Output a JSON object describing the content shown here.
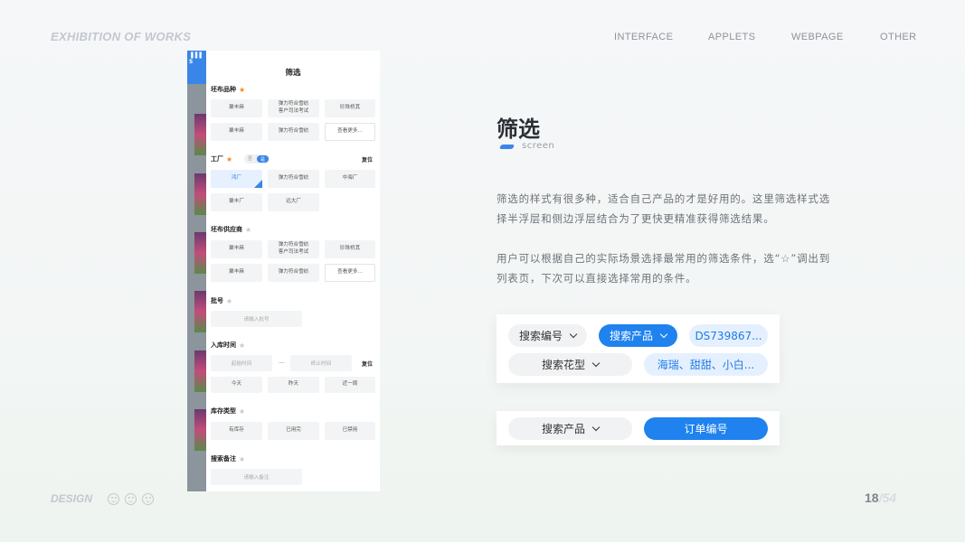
{
  "header": {
    "brand": "EXHIBITION OF WORKS",
    "nav": [
      "INTERFACE",
      "APPLETS",
      "WEBPAGE",
      "OTHER"
    ]
  },
  "footer": {
    "design": "DESIGN",
    "page_current": "18",
    "page_total": "/54"
  },
  "phone": {
    "status": "▐▐▐ S",
    "title": "筛选",
    "sections": {
      "fabric": {
        "label": "坯布品种",
        "chips": [
          "聚丰麻",
          "弹力符合雪纺\n客户司法考试",
          "珍珠桥其",
          "聚丰麻",
          "弹力符合雪纺",
          "查看更多..."
        ]
      },
      "factory": {
        "label": "工厂",
        "reset": "复位",
        "toggle_off": "否",
        "toggle_on": "是",
        "chips": [
          "鸿厂",
          "弹力符合雪纺",
          "中海厂",
          "聚丰厂",
          "远大厂"
        ]
      },
      "supplier": {
        "label": "坯布供应商",
        "chips": [
          "聚丰麻",
          "弹力符合雪纺\n客户司法考试",
          "珍珠桥其",
          "聚丰麻",
          "弹力符合雪纺",
          "查看更多..."
        ]
      },
      "batch": {
        "label": "批号",
        "placeholder": "请输入批号"
      },
      "time": {
        "label": "入库时间",
        "start": "起始时间",
        "end": "终止时间",
        "sep": "—",
        "reset": "复位",
        "chips": [
          "今天",
          "昨天",
          "近一周"
        ]
      },
      "stock": {
        "label": "库存类型",
        "chips": [
          "有库存",
          "已用完",
          "已禁用"
        ]
      },
      "remark": {
        "label": "搜索备注",
        "placeholder": "请输入备注"
      }
    }
  },
  "content": {
    "title": "筛选",
    "subtitle": "screen",
    "para1": "筛选的样式有很多种，适合自己产品的才是好用的。这里筛选样式选择半浮层和侧边浮层结合为了更快更精准获得筛选结果。",
    "para2": "用户可以根据自己的实际场景选择最常用的筛选条件，选“☆”调出到列表页，下次可以直接选择常用的条件。"
  },
  "filter_card1": {
    "row1": [
      "搜索编号",
      "搜索产品",
      "DS739867..."
    ],
    "row2": [
      "搜索花型",
      "海瑞、甜甜、小白..."
    ]
  },
  "filter_card2": {
    "items": [
      "搜索产品",
      "订单编号"
    ]
  },
  "colors": {
    "accent": "#1f82ee",
    "accent_light": "#e5f0ff",
    "star_active": "#f08c1e"
  }
}
